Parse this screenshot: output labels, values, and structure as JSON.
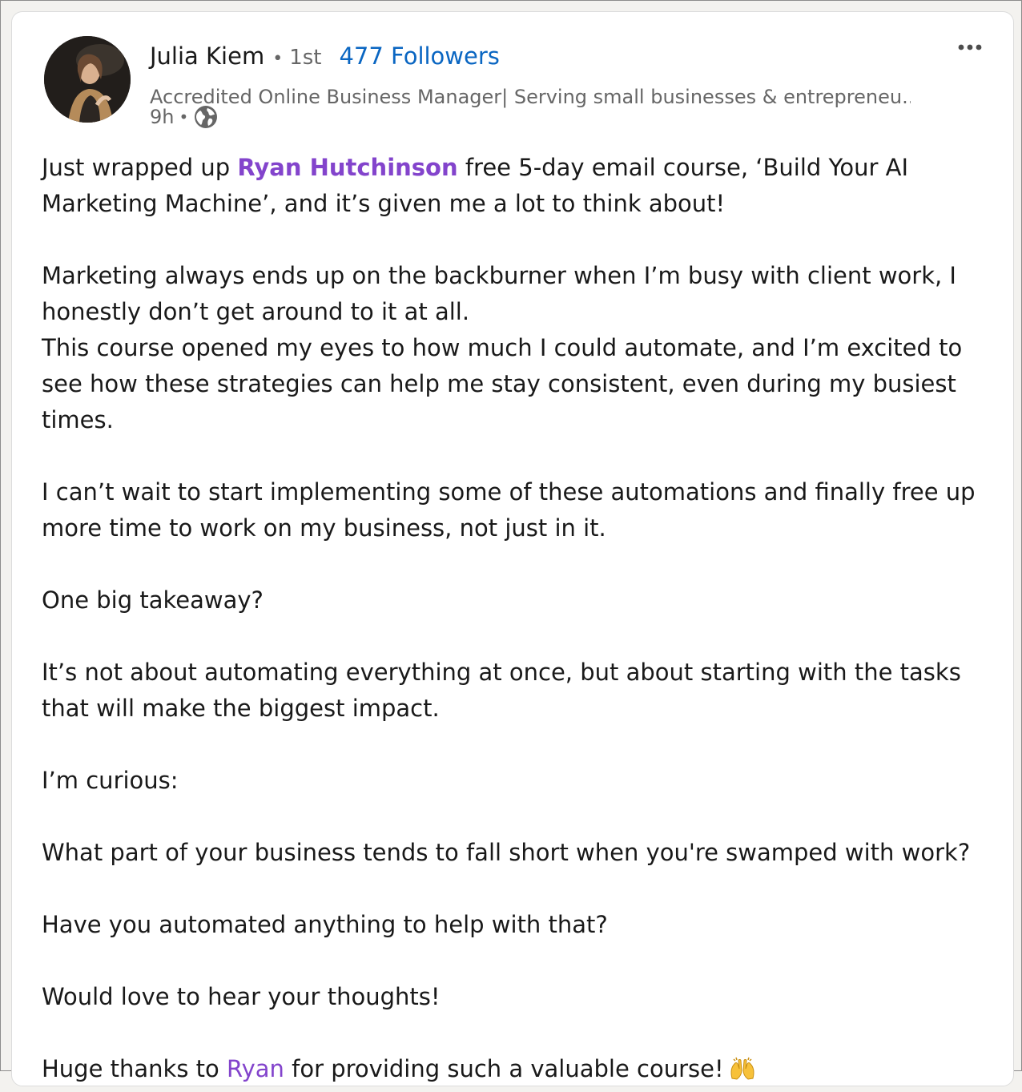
{
  "author": {
    "name": "Julia Kiem",
    "separator": "•",
    "degree": "1st",
    "followers": "477 Followers",
    "headline": "Accredited Online Business Manager| Serving small businesses & entrepreneu...",
    "time": "9h",
    "time_separator": "•",
    "visibility_icon": "globe-icon"
  },
  "post": {
    "p1_a": "Just wrapped up ",
    "p1_mention": "Ryan Hutchinson",
    "p1_b": " free 5-day email course, ‘Build Your AI Marketing Machine’, and it’s given me a lot to think about!",
    "p2": "Marketing always ends up on the backburner when I’m busy with client work, I honestly don’t get around to it at all.",
    "p3": "This course opened my eyes to how much I could automate, and I’m excited to see how these strategies can help me stay consistent, even during my busiest times.",
    "p4": "I can’t wait to start implementing some of these automations and finally free up more time to work on my business, not just in it.",
    "p5": "One big takeaway?",
    "p6": "It’s not about automating everything at once, but about starting with the tasks that will make the biggest impact.",
    "p7": "I’m curious:",
    "p8": "What part of your business tends to fall short when you're swamped with work?",
    "p9": "Have you automated anything to help with that?",
    "p10": "Would love to hear your thoughts!",
    "p11_a": "Huge thanks to ",
    "p11_mention": "Ryan",
    "p11_b": " for providing such a valuable course!",
    "p11_emoji": "raising-hands-emoji"
  },
  "colors": {
    "follower_blue": "#0a66c2",
    "mention_purple": "#8344cc",
    "text": "#191919",
    "muted": "#666666"
  }
}
